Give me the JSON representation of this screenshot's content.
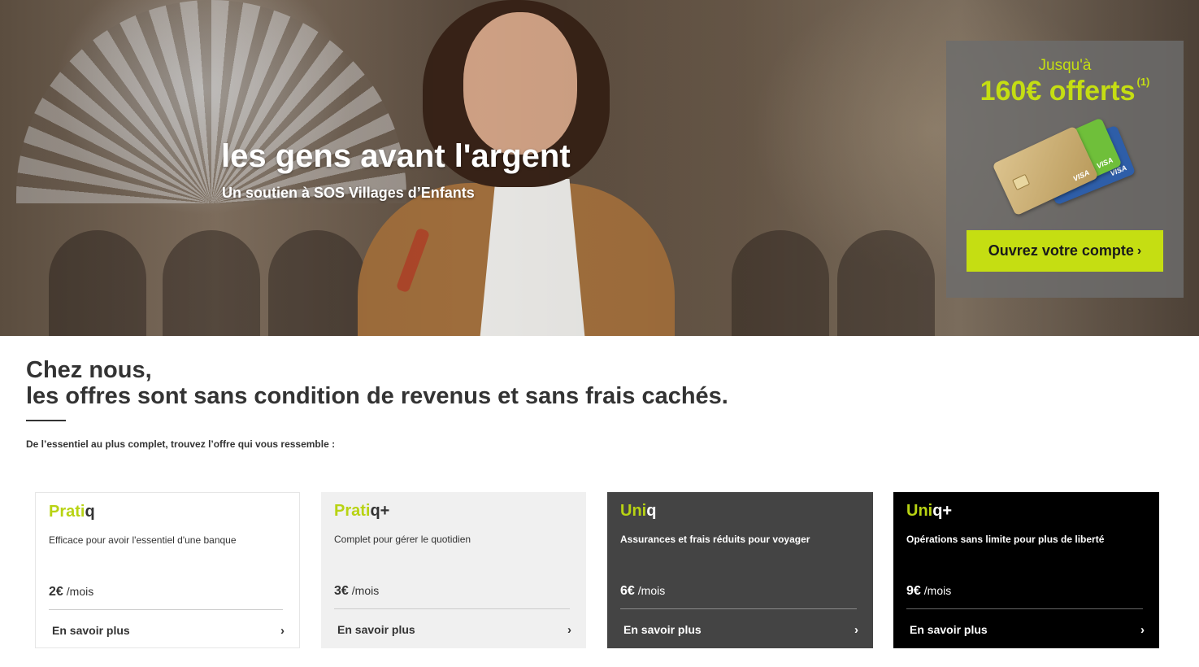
{
  "hero": {
    "title": "les gens avant l'argent",
    "subtitle": "Un soutien à SOS Villages d’Enfants"
  },
  "promo": {
    "intro": "Jusqu'à",
    "amount": "160€ offerts",
    "footnote": "(1)",
    "card_brand_label": "VISA",
    "cta_label": "Ouvrez votre compte",
    "cta_chevron": "›",
    "accent_color": "#c5de12"
  },
  "intro": {
    "title_line1": "Chez nous,",
    "title_line2": "les offres sont sans condition de revenus et sans frais cachés.",
    "text": "De l’essentiel au plus complet, trouvez l’offre qui vous ressemble :"
  },
  "offers": [
    {
      "name_accent": "Prati",
      "name_rest": "q",
      "description": "Efficace pour avoir l'essentiel d'une banque",
      "price": "2€",
      "unit": "/mois",
      "link_label": "En savoir plus",
      "link_chevron": "›",
      "background": "#ffffff"
    },
    {
      "name_accent": "Prati",
      "name_rest": "q+",
      "description": "Complet pour gérer le quotidien",
      "price": "3€",
      "unit": "/mois",
      "link_label": "En savoir plus",
      "link_chevron": "›",
      "background": "#f0f0f0"
    },
    {
      "name_accent": "Uni",
      "name_rest": "q",
      "description": "Assurances et frais réduits pour voyager",
      "price": "6€",
      "unit": "/mois",
      "link_label": "En savoir plus",
      "link_chevron": "›",
      "background": "#444444"
    },
    {
      "name_accent": "Uni",
      "name_rest": "q+",
      "description": "Opérations sans limite pour plus de liberté",
      "price": "9€",
      "unit": "/mois",
      "link_label": "En savoir plus",
      "link_chevron": "›",
      "background": "#000000"
    }
  ],
  "colors": {
    "brand_accent": "#b8d313",
    "text_dark": "#333333"
  }
}
